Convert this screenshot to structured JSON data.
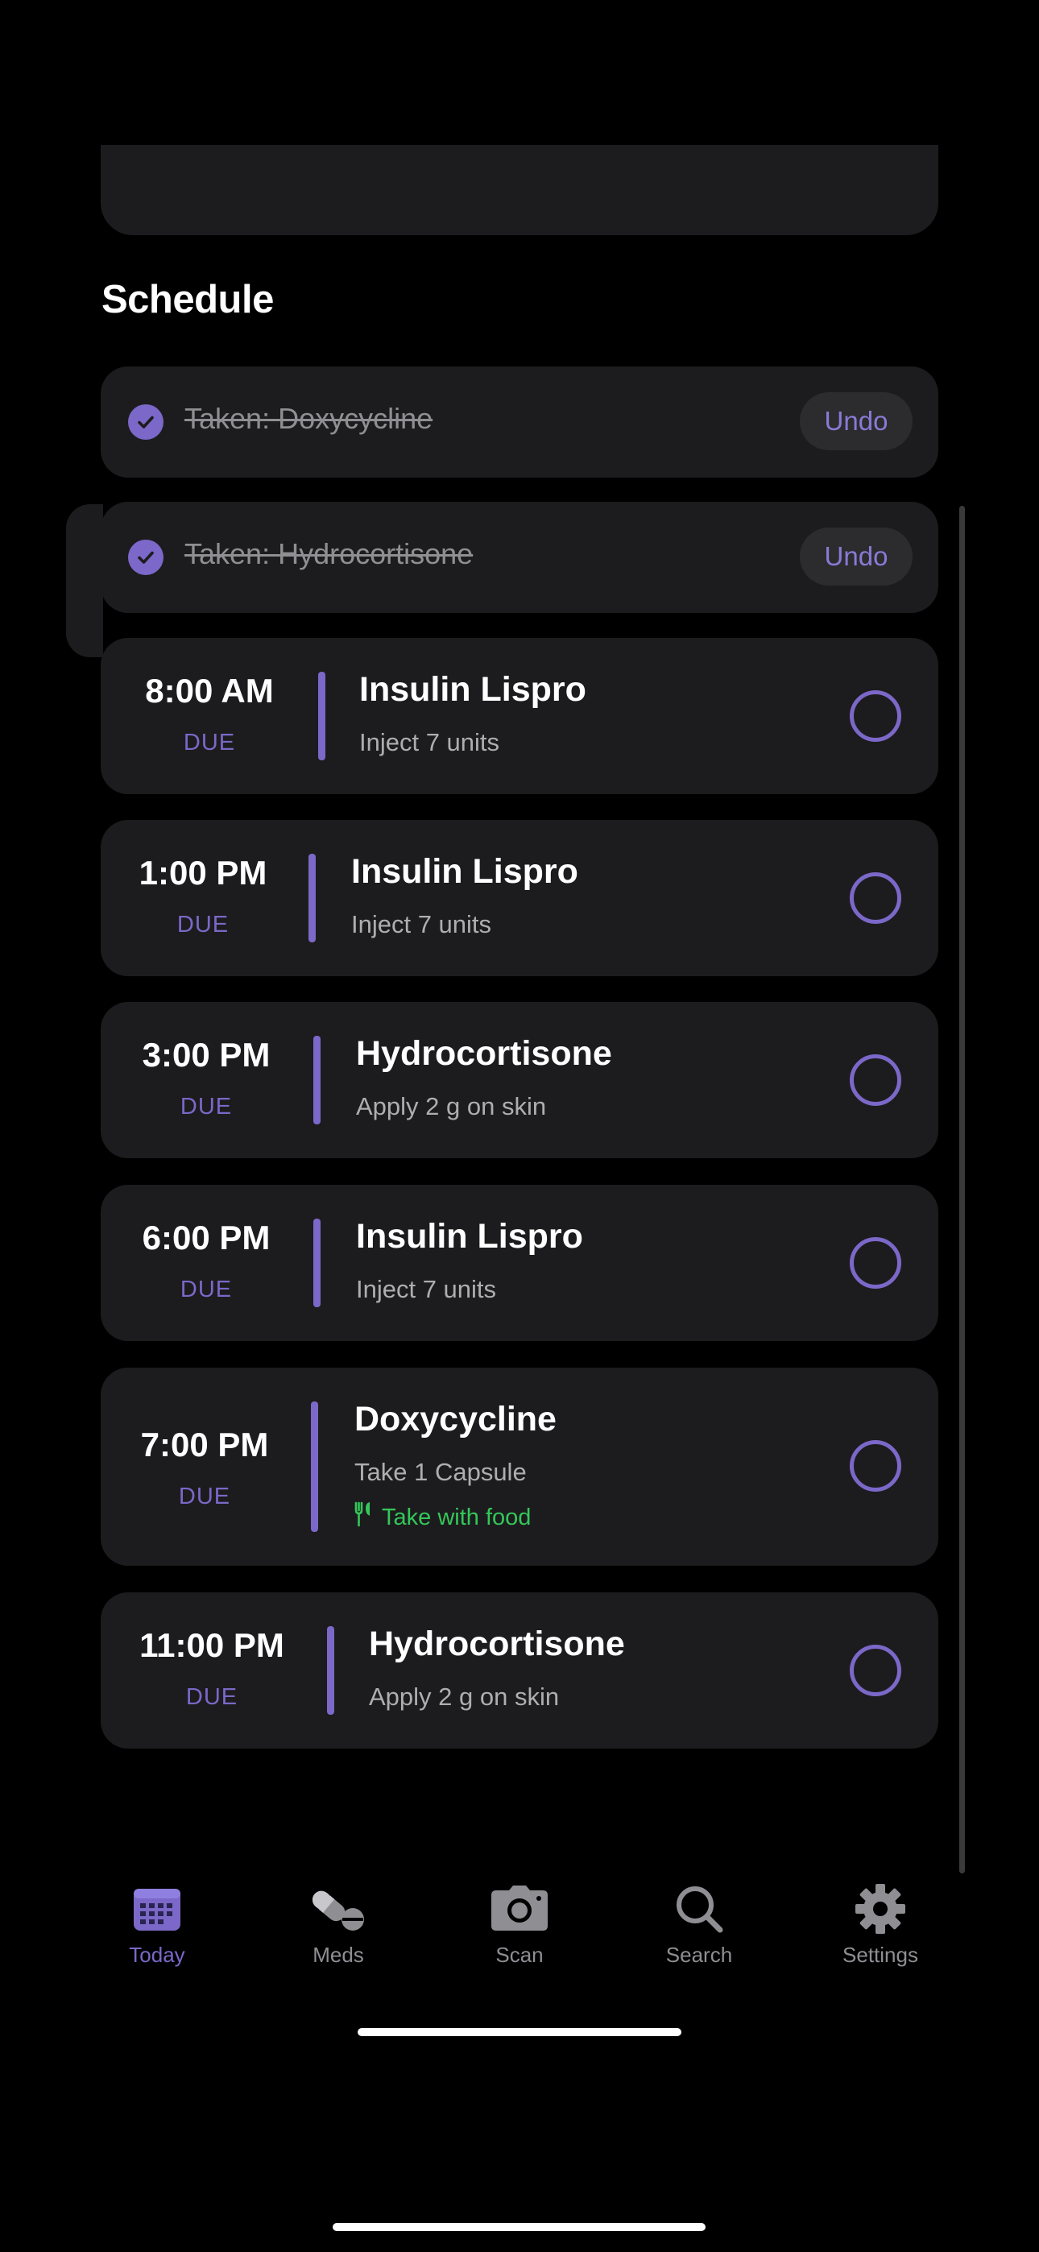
{
  "section_title": "Schedule",
  "colors": {
    "accent": "#7b68c8",
    "card": "#1c1c1e",
    "food": "#34c759",
    "muted": "#8e8e93"
  },
  "taken": [
    {
      "label": "Taken: Doxycycline",
      "undo": "Undo"
    },
    {
      "label": "Taken: Hydrocortisone",
      "undo": "Undo"
    }
  ],
  "doses": [
    {
      "time": "8:00 AM",
      "status": "DUE",
      "name": "Insulin Lispro",
      "instruction": "Inject 7 units"
    },
    {
      "time": "1:00 PM",
      "status": "DUE",
      "name": "Insulin Lispro",
      "instruction": "Inject 7 units"
    },
    {
      "time": "3:00 PM",
      "status": "DUE",
      "name": "Hydrocortisone",
      "instruction": "Apply 2 g on skin"
    },
    {
      "time": "6:00 PM",
      "status": "DUE",
      "name": "Insulin Lispro",
      "instruction": "Inject 7 units"
    },
    {
      "time": "7:00 PM",
      "status": "DUE",
      "name": "Doxycycline",
      "instruction": "Take 1 Capsule",
      "note": "Take with food",
      "note_icon": "fork-knife-icon"
    },
    {
      "time": "11:00 PM",
      "status": "DUE",
      "name": "Hydrocortisone",
      "instruction": "Apply 2 g on skin"
    }
  ],
  "tabs": [
    {
      "label": "Today",
      "icon": "calendar-icon",
      "active": true
    },
    {
      "label": "Meds",
      "icon": "pills-icon",
      "active": false
    },
    {
      "label": "Scan",
      "icon": "camera-icon",
      "active": false
    },
    {
      "label": "Search",
      "icon": "search-icon",
      "active": false
    },
    {
      "label": "Settings",
      "icon": "gear-icon",
      "active": false
    }
  ]
}
